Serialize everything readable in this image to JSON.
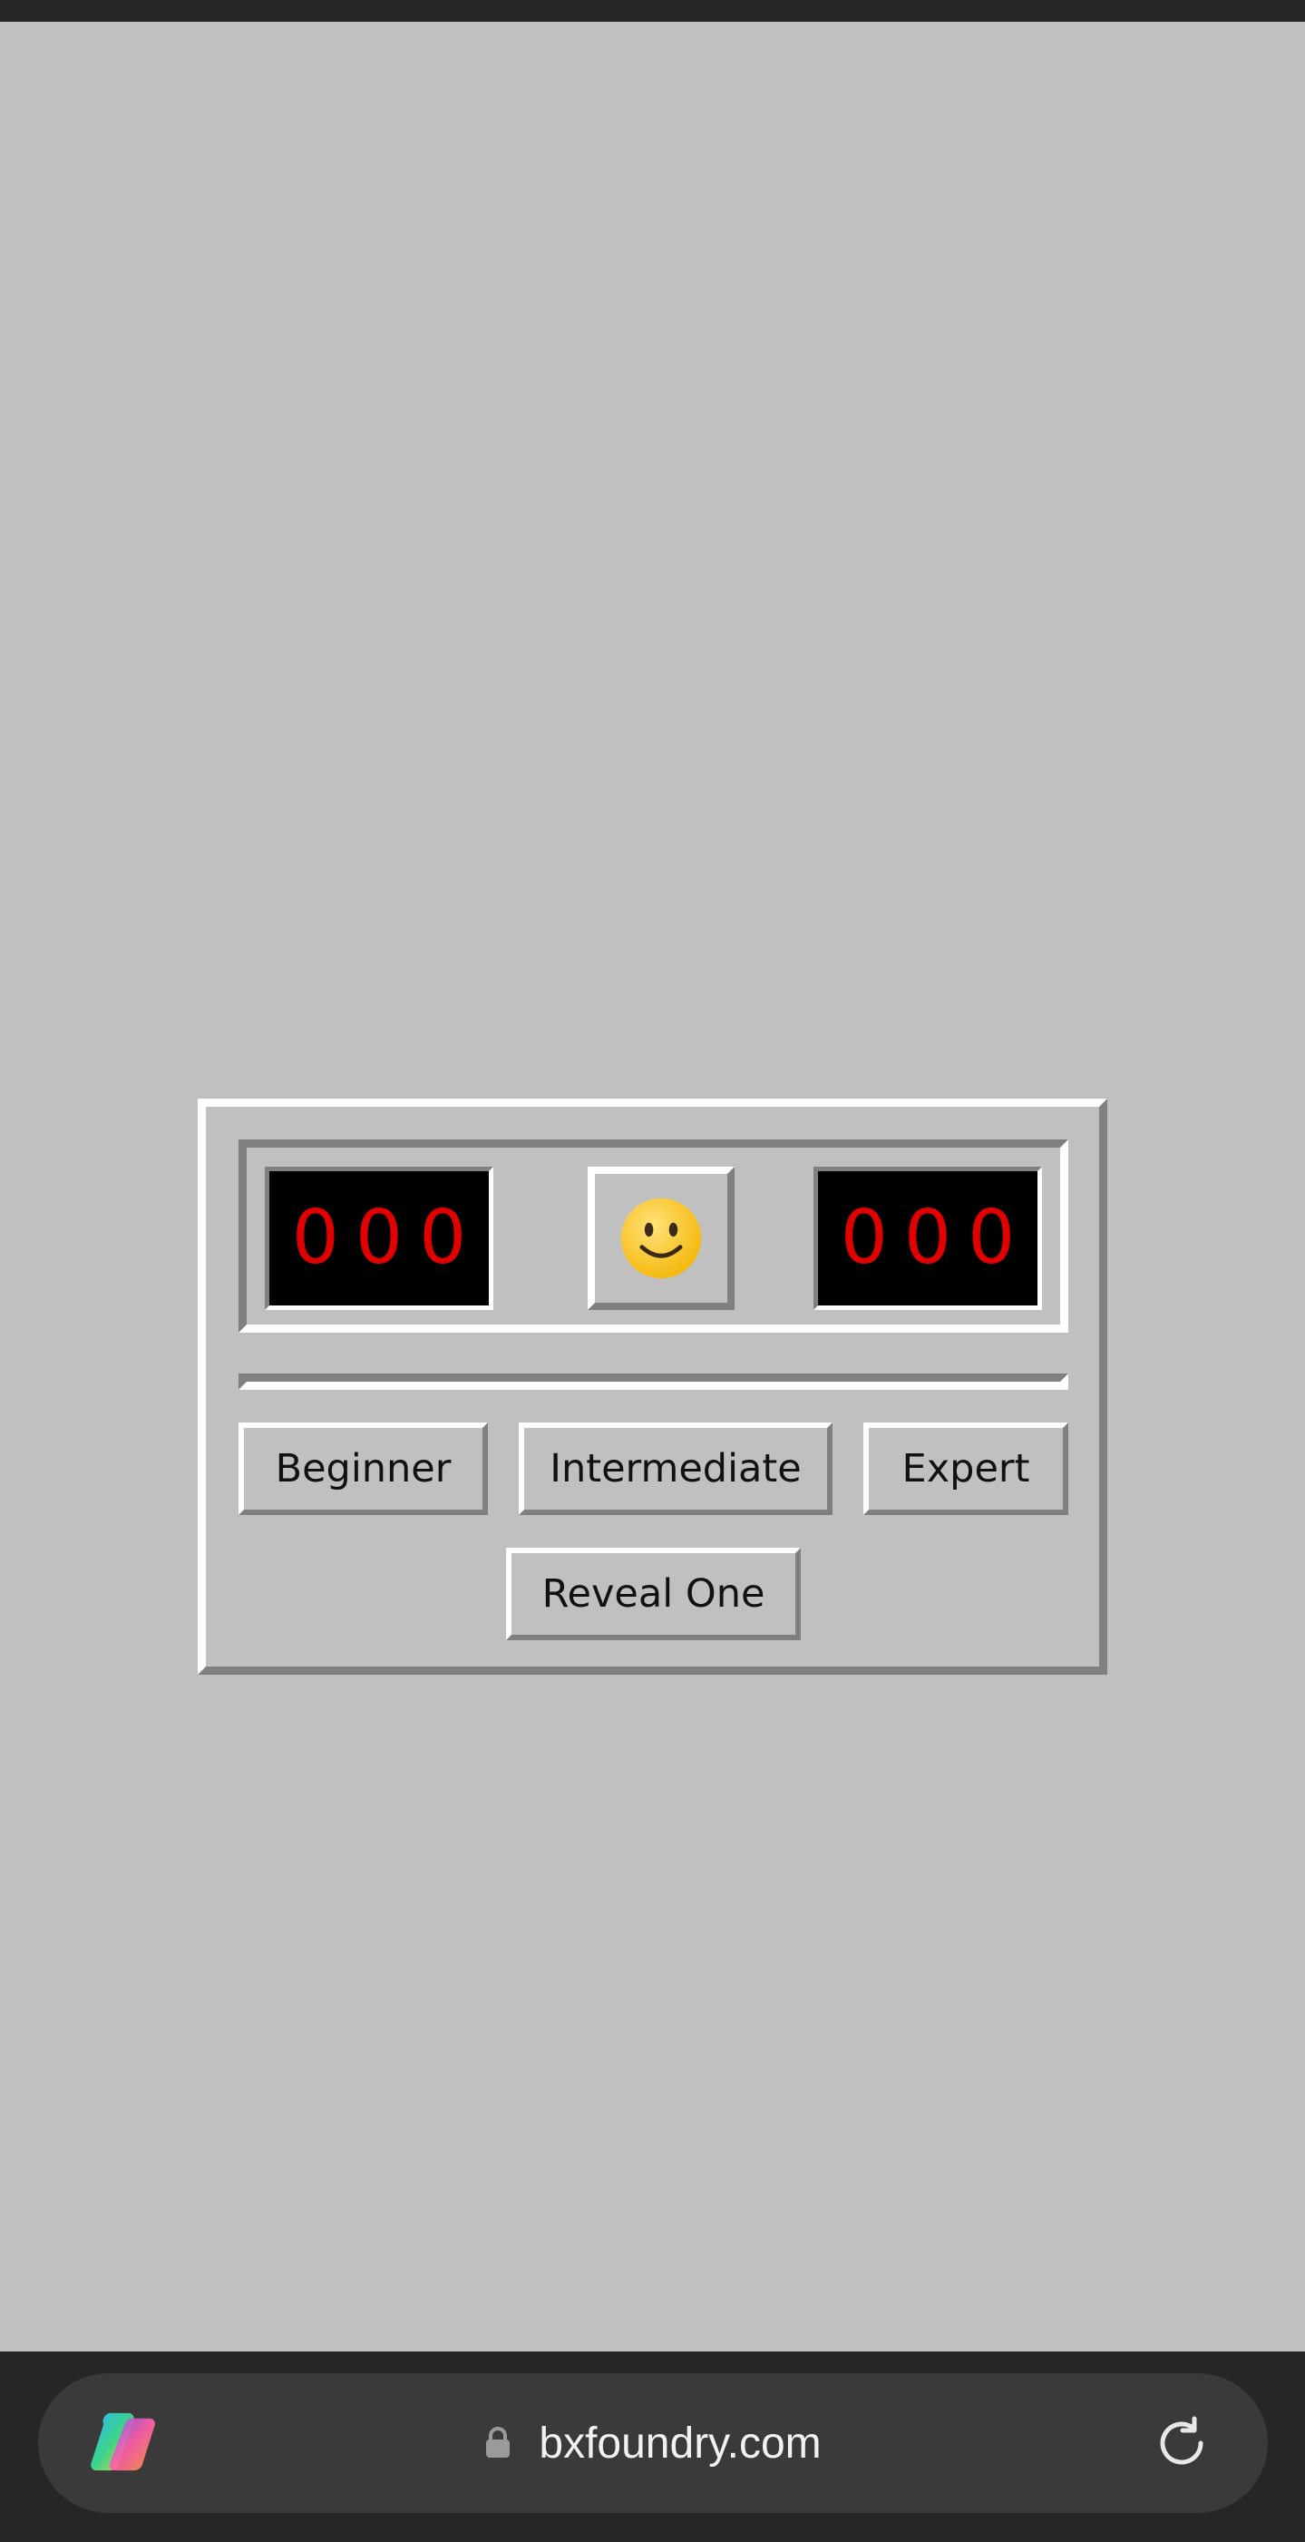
{
  "game": {
    "mine_counter": "000",
    "timer": "000",
    "face": "smiley-face-icon",
    "buttons": {
      "beginner": "Beginner",
      "intermediate": "Intermediate",
      "expert": "Expert",
      "reveal_one": "Reveal One"
    },
    "colors": {
      "background": "#c0c0c0",
      "counter_bg": "#000000",
      "counter_digits": "#e00000",
      "bevel_light": "#ffffff",
      "bevel_dark": "#808080"
    }
  },
  "browser": {
    "url": "bxfoundry.com",
    "icons": [
      "copilot-icon",
      "lock-icon",
      "reload-icon"
    ]
  }
}
